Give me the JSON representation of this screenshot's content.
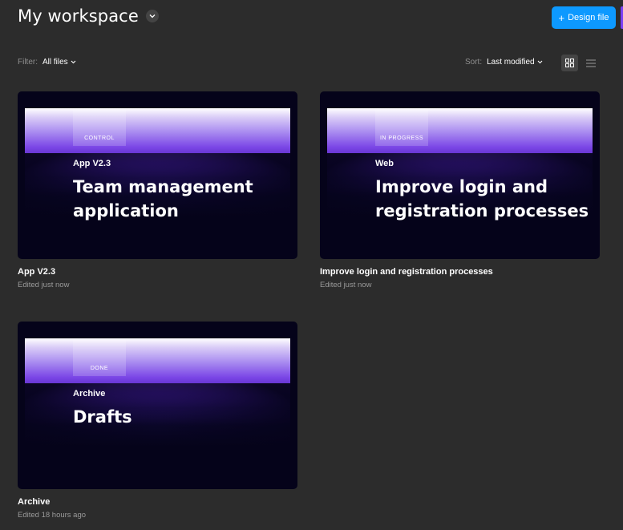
{
  "header": {
    "title": "My workspace",
    "new_button_label": "Design file"
  },
  "toolbar": {
    "filter_label": "Filter:",
    "filter_value": "All files",
    "sort_label": "Sort:",
    "sort_value": "Last modified",
    "active_view": "grid"
  },
  "files": [
    {
      "tag": "CONTROL",
      "project": "App V2.3",
      "headline": "Team management application",
      "name": "App V2.3",
      "edited": "Edited just now"
    },
    {
      "tag": "IN PROGRESS",
      "project": "Web",
      "headline": "Improve login and registration processes",
      "name": "Improve login and registration processes",
      "edited": "Edited just now"
    },
    {
      "tag": "DONE",
      "project": "Archive",
      "headline": "Drafts",
      "name": "Archive",
      "edited": "Edited 18 hours ago"
    }
  ],
  "colors": {
    "background": "#2c2c2c",
    "accent": "#0d99ff",
    "thumbnail_dark": "#05031a",
    "thumbnail_purple": "#7a45e6"
  }
}
